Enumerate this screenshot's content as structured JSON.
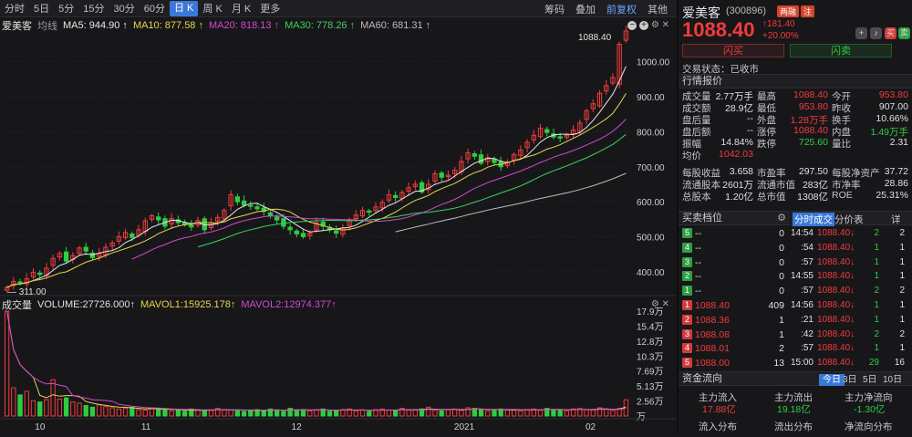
{
  "toolbar": {
    "periods": [
      "分时",
      "5日",
      "5分",
      "15分",
      "30分",
      "60分",
      "日 K",
      "周 K",
      "月 K",
      "更多"
    ],
    "active_period": "日 K",
    "right_items": [
      "筹码",
      "叠加",
      "前复权",
      "其他"
    ]
  },
  "chart_legend": {
    "name": "爱美客",
    "type": "均线",
    "ma5": "MA5: 944.90",
    "ma10": "MA10: 877.58",
    "ma20": "MA20: 818.13",
    "ma30": "MA30: 778.26",
    "ma60": "MA60: 681.31"
  },
  "volume_legend": {
    "name": "成交量",
    "vol": "VOLUME:27726.000",
    "mavol1": "MAVOL1:15925.178",
    "mavol2": "MAVOL2:12974.377"
  },
  "colors": {
    "up": "#f23b3b",
    "down": "#2ecc40",
    "ma5": "#e8e8e8",
    "ma10": "#e6d64a",
    "ma20": "#d14ad0",
    "ma30": "#3fd15a",
    "ma60": "#bdbdbd"
  },
  "chart_data": {
    "type": "candlestick",
    "ylim": [
      350,
      1080
    ],
    "y_ticks": [
      "1000.00",
      "900.00",
      "800.00",
      "700.00",
      "600.00",
      "500.00",
      "400.00"
    ],
    "high_label": "1088.40",
    "low_label": "311.00",
    "x_labels": [
      "10",
      "11",
      "12",
      "2021",
      "02"
    ],
    "volume_ticks": [
      "17.9万",
      "15.4万",
      "12.8万",
      "10.3万",
      "7.69万",
      "5.13万",
      "2.56万",
      "万"
    ],
    "closes": [
      355,
      372,
      368,
      380,
      398,
      392,
      410,
      438,
      452,
      430,
      446,
      468,
      459,
      440,
      452,
      470,
      482,
      500,
      512,
      498,
      520,
      545,
      560,
      548,
      530,
      552,
      540,
      535,
      528,
      546,
      520,
      540,
      555,
      575,
      620,
      600,
      590,
      588,
      580,
      572,
      560,
      548,
      530,
      520,
      508,
      500,
      510,
      540,
      530,
      520,
      510,
      525,
      548,
      562,
      575,
      570,
      585,
      598,
      620,
      612,
      626,
      640,
      650,
      628,
      650,
      680,
      670,
      676,
      690,
      715,
      740,
      730,
      710,
      726,
      712,
      700,
      712,
      735,
      748,
      770,
      790,
      810,
      798,
      785,
      782,
      790,
      805,
      825,
      860,
      880,
      910,
      932,
      955,
      1050,
      1088
    ],
    "volumes": [
      17.9,
      4.8,
      3.6,
      4.2,
      2.6,
      2.4,
      2.8,
      6.2,
      2.9,
      3.1,
      2.4,
      2.2,
      1.8,
      1.5,
      1.9,
      1.6,
      1.4,
      1.2,
      1.3,
      1.5,
      1.1,
      1.0,
      1.4,
      1.2,
      1.1,
      0.9,
      1.0,
      0.8,
      1.2,
      1.1,
      0.9,
      1.0,
      1.3,
      1.1,
      1.0,
      0.9,
      0.8,
      1.0,
      1.1,
      0.9,
      1.2,
      1.0,
      0.8,
      1.3,
      1.0,
      1.1,
      0.9,
      1.0,
      1.2,
      0.8,
      1.0,
      1.1,
      1.2,
      0.9,
      1.0,
      0.8,
      1.1,
      1.2,
      1.0,
      0.9,
      1.3,
      1.0,
      1.1,
      1.2,
      1.5,
      1.0,
      0.9,
      1.1,
      1.2,
      1.0,
      1.4,
      1.3,
      1.1,
      0.9,
      1.0,
      1.2,
      1.1,
      1.0,
      0.9,
      1.1,
      1.2,
      1.0,
      1.3,
      1.1,
      1.0,
      0.9,
      1.2,
      1.3,
      1.1,
      1.0,
      1.4,
      1.2,
      1.0,
      1.3,
      2.77
    ]
  },
  "stock": {
    "name": "爱美客",
    "code": "(300896)",
    "badge1": "两融",
    "badge2": "注",
    "price": "1088.40",
    "change": "↑181.40",
    "change_pct": "+20.00%",
    "buy_label": "闪买",
    "sell_label": "闪卖",
    "status": "交易状态：已收市"
  },
  "quote": {
    "title": "行情报价",
    "rows": [
      [
        [
          "成交量",
          "2.77万手",
          "white"
        ],
        [
          "最高",
          "1088.40",
          "red"
        ],
        [
          "今开",
          "953.80",
          "red"
        ]
      ],
      [
        [
          "成交额",
          "28.9亿",
          "white"
        ],
        [
          "最低",
          "953.80",
          "red"
        ],
        [
          "昨收",
          "907.00",
          "white"
        ]
      ],
      [
        [
          "盘后量",
          "--",
          "white"
        ],
        [
          "外盘",
          "1.28万手",
          "red"
        ],
        [
          "换手",
          "10.66%",
          "white"
        ]
      ],
      [
        [
          "盘后额",
          "--",
          "white"
        ],
        [
          "涨停",
          "1088.40",
          "red"
        ],
        [
          "内盘",
          "1.49万手",
          "green"
        ]
      ],
      [
        [
          "振幅",
          "14.84%",
          "white"
        ],
        [
          "跌停",
          "725.60",
          "green"
        ],
        [
          "量比",
          "2.31",
          "white"
        ]
      ],
      [
        [
          "均价",
          "1042.03",
          "red"
        ],
        [
          "",
          "",
          " white"
        ],
        [
          "",
          "",
          "white"
        ]
      ]
    ],
    "fund_rows": [
      [
        [
          "每股收益",
          "3.658"
        ],
        [
          "市盈率",
          "297.50"
        ],
        [
          "每股净资产",
          "37.72"
        ]
      ],
      [
        [
          "流通股本",
          "2601万"
        ],
        [
          "流通市值",
          "283亿"
        ],
        [
          "市净率",
          "28.86"
        ]
      ],
      [
        [
          "总股本",
          "1.20亿"
        ],
        [
          "总市值",
          "1308亿"
        ],
        [
          "ROE",
          "25.31%"
        ]
      ]
    ]
  },
  "orderbook": {
    "title": "买卖档位",
    "rows": [
      {
        "tag": "5",
        "side": "sell",
        "price": "--",
        "vol": "0"
      },
      {
        "tag": "4",
        "side": "sell",
        "price": "--",
        "vol": "0"
      },
      {
        "tag": "3",
        "side": "sell",
        "price": "--",
        "vol": "0"
      },
      {
        "tag": "2",
        "side": "sell",
        "price": "--",
        "vol": "0"
      },
      {
        "tag": "1",
        "side": "sell",
        "price": "--",
        "vol": "0"
      },
      {
        "tag": "1",
        "side": "buy",
        "price": "1088.40",
        "vol": "409"
      },
      {
        "tag": "2",
        "side": "buy",
        "price": "1088.36",
        "vol": "1"
      },
      {
        "tag": "3",
        "side": "buy",
        "price": "1088.08",
        "vol": "1"
      },
      {
        "tag": "4",
        "side": "buy",
        "price": "1088.01",
        "vol": "2"
      },
      {
        "tag": "5",
        "side": "buy",
        "price": "1088.00",
        "vol": "13"
      }
    ]
  },
  "ticks": {
    "tab1": "分时成交",
    "tab2": "分价表",
    "tab3": "详",
    "rows": [
      {
        "time": "14:54",
        "price": "1088.40",
        "vol": "2",
        "n": "2"
      },
      {
        "time": ":54",
        "price": "1088.40",
        "vol": "1",
        "n": "1"
      },
      {
        "time": ":57",
        "price": "1088.40",
        "vol": "1",
        "n": "1"
      },
      {
        "time": "14:55",
        "price": "1088.40",
        "vol": "1",
        "n": "1"
      },
      {
        "time": ":57",
        "price": "1088.40",
        "vol": "2",
        "n": "2"
      },
      {
        "time": "14:56",
        "price": "1088.40",
        "vol": "1",
        "n": "1"
      },
      {
        "time": ":21",
        "price": "1088.40",
        "vol": "1",
        "n": "1"
      },
      {
        "time": ":42",
        "price": "1088.40",
        "vol": "2",
        "n": "2"
      },
      {
        "time": ":57",
        "price": "1088.40",
        "vol": "1",
        "n": "1"
      },
      {
        "time": "15:00",
        "price": "1088.40",
        "vol": "29",
        "n": "16"
      }
    ]
  },
  "funds": {
    "title": "资金流向",
    "tabs": [
      "今日",
      "3日",
      "5日",
      "10日"
    ],
    "in_label": "主力流入",
    "in_value": "17.88亿",
    "out_label": "主力流出",
    "out_value": "19.18亿",
    "net_label": "主力净流向",
    "net_value": "-1.30亿",
    "dist1": "流入分布",
    "dist2": "流出分布",
    "dist3": "净流向分布"
  }
}
